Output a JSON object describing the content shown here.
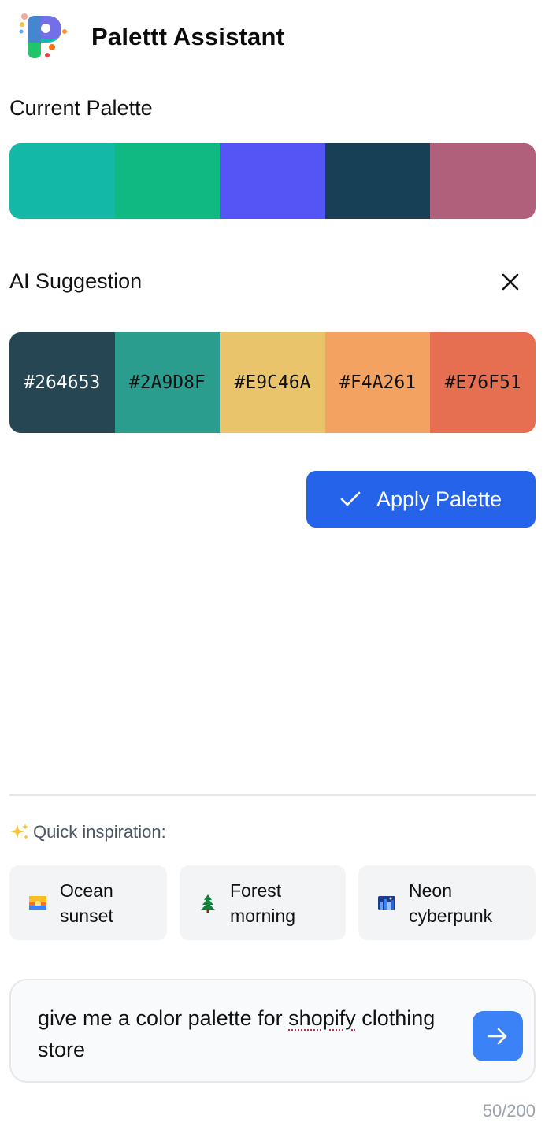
{
  "header": {
    "app_title": "Palettt Assistant",
    "logo_icon": "palettt-logo-icon"
  },
  "current_palette": {
    "title": "Current Palette",
    "colors": [
      "#14b8a6",
      "#10b981",
      "#5555f5",
      "#173f56",
      "#b0607a"
    ]
  },
  "suggestion": {
    "title": "AI Suggestion",
    "close_icon": "close-icon",
    "colors": [
      {
        "hex": "#264653",
        "text_color": "#ffffff"
      },
      {
        "hex": "#2A9D8F",
        "text_color": "#111111"
      },
      {
        "hex": "#E9C46A",
        "text_color": "#111111"
      },
      {
        "hex": "#F4A261",
        "text_color": "#111111"
      },
      {
        "hex": "#E76F51",
        "text_color": "#111111"
      }
    ],
    "apply_label": "Apply Palette",
    "apply_icon": "check-icon"
  },
  "inspiration": {
    "label": "Quick inspiration:",
    "sparkle_icon": "sparkles-icon",
    "chips": [
      {
        "line1": "Ocean",
        "line2": "sunset",
        "icon": "sunset-image-icon"
      },
      {
        "line1": "Forest",
        "line2": "morning",
        "icon": "evergreen-tree-icon"
      },
      {
        "line1": "Neon",
        "line2": "cyberpunk",
        "icon": "night-city-image-icon"
      }
    ]
  },
  "prompt": {
    "text_before": "give me a color palette for ",
    "misspelled_word": "shopify",
    "text_after": " clothing store",
    "send_icon": "arrow-right-icon",
    "counter": "50/200"
  },
  "colors": {
    "accent": "#2563eb",
    "send": "#3b82f6"
  }
}
